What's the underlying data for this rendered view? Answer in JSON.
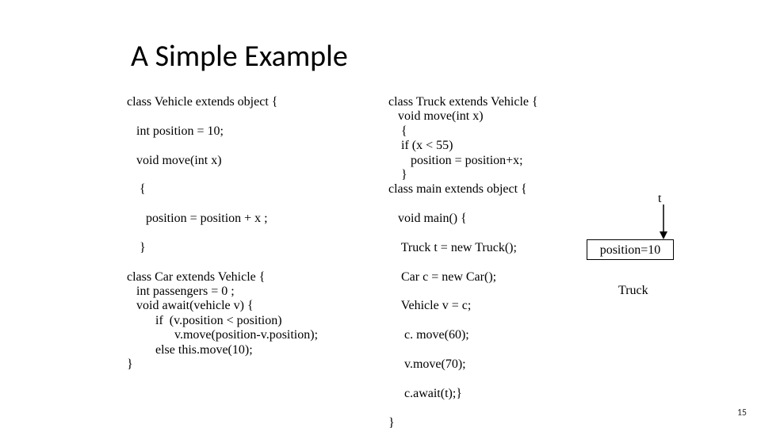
{
  "title": "A Simple Example",
  "page_number": "15",
  "left_code": "class Vehicle extends object {\n\n   int position = 10;\n\n   void move(int x)\n\n    {\n\n      position = position + x ;\n\n    }\n\nclass Car extends Vehicle {\n   int passengers = 0 ;\n   void await(vehicle v) {\n         if  (v.position < position)\n               v.move(position-v.position);\n         else this.move(10);\n}",
  "right_code": "class Truck extends Vehicle {\n   void move(int x)\n    {\n    if (x < 55)\n       position = position+x;\n    }\nclass main extends object {\n\n   void main() {\n\n    Truck t = new Truck();\n\n    Car c = new Car();\n\n    Vehicle v = c;\n\n     c. move(60);\n\n     v.move(70);\n\n     c.await(t);}\n\n}",
  "diagram": {
    "t_label": "t",
    "box_text": "position=10",
    "truck_label": "Truck"
  }
}
